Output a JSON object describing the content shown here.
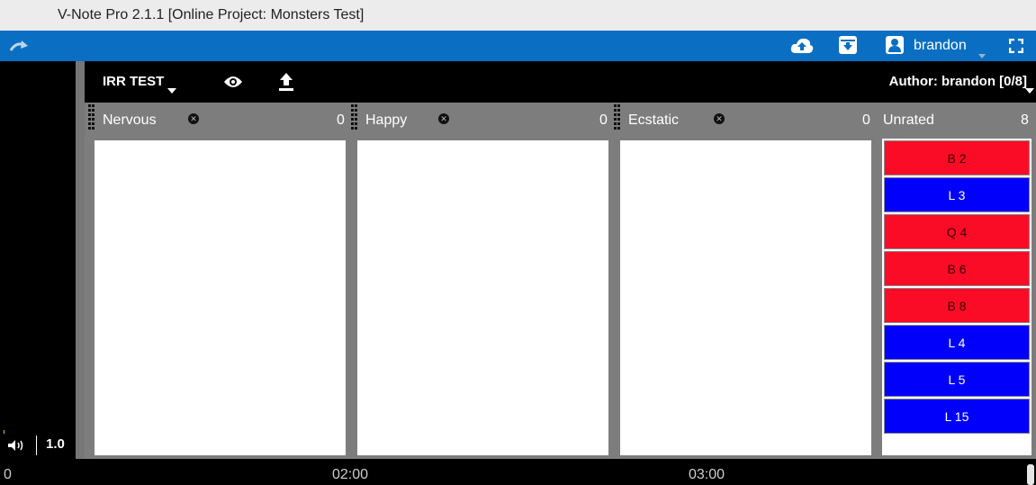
{
  "window": {
    "title": "V-Note Pro 2.1.1 [Online Project: Monsters Test]"
  },
  "topbar": {
    "icons": [
      "redo-icon",
      "cloud-upload-icon",
      "download-box-icon",
      "user-icon",
      "fullscreen-icon"
    ],
    "username": "brandon",
    "color": "#0a6fc2"
  },
  "toolbar": {
    "project_name": "IRR TEST",
    "author_label": "Author: brandon [0/8]"
  },
  "player": {
    "speed": "1.0"
  },
  "columns": [
    {
      "name": "Nervous",
      "count": "0"
    },
    {
      "name": "Happy",
      "count": "0"
    },
    {
      "name": "Ecstatic",
      "count": "0"
    }
  ],
  "unrated": {
    "name": "Unrated",
    "count": "8",
    "cards": [
      {
        "label": "B 2",
        "color": "red"
      },
      {
        "label": "L 3",
        "color": "blue"
      },
      {
        "label": "Q 4",
        "color": "red"
      },
      {
        "label": "B 6",
        "color": "red"
      },
      {
        "label": "B 8",
        "color": "red"
      },
      {
        "label": "L 4",
        "color": "blue"
      },
      {
        "label": "L 5",
        "color": "blue"
      },
      {
        "label": "L 15",
        "color": "blue"
      }
    ]
  },
  "timeline": {
    "ticks": [
      "0",
      "02:00",
      "03:00"
    ]
  },
  "colors": {
    "red_card": "#fb0c26",
    "blue_card": "#0000fb"
  }
}
